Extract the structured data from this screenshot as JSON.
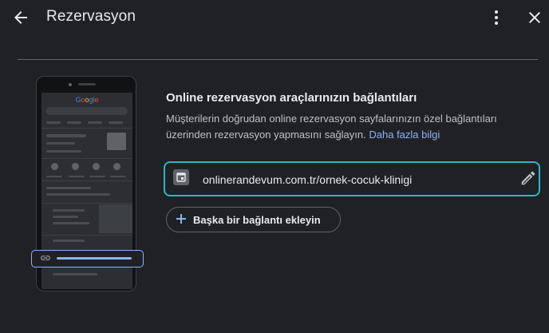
{
  "header": {
    "title": "Rezervasyon"
  },
  "illustration": {
    "brand": [
      "G",
      "o",
      "o",
      "g",
      "l",
      "e"
    ],
    "brand_colors": [
      "#4285f4",
      "#ea4335",
      "#fbbc05",
      "#4285f4",
      "#34a853",
      "#ea4335"
    ]
  },
  "main": {
    "section_title": "Online rezervasyon araçlarınızın bağlantıları",
    "description": "Müşterilerin doğrudan online rezervasyon sayfalarınızın özel bağlantıları üzerinden rezervasyon yapmasını sağlayın.",
    "learn_more": "Daha fazla bilgi",
    "link_value": "onlinerandevum.com.tr/ornek-cocuk-klinigi",
    "add_link_label": "Başka bir bağlantı ekleyin"
  },
  "colors": {
    "background": "#202124",
    "accent": "#8ab4f8",
    "focus_border": "#2fb5c4"
  }
}
